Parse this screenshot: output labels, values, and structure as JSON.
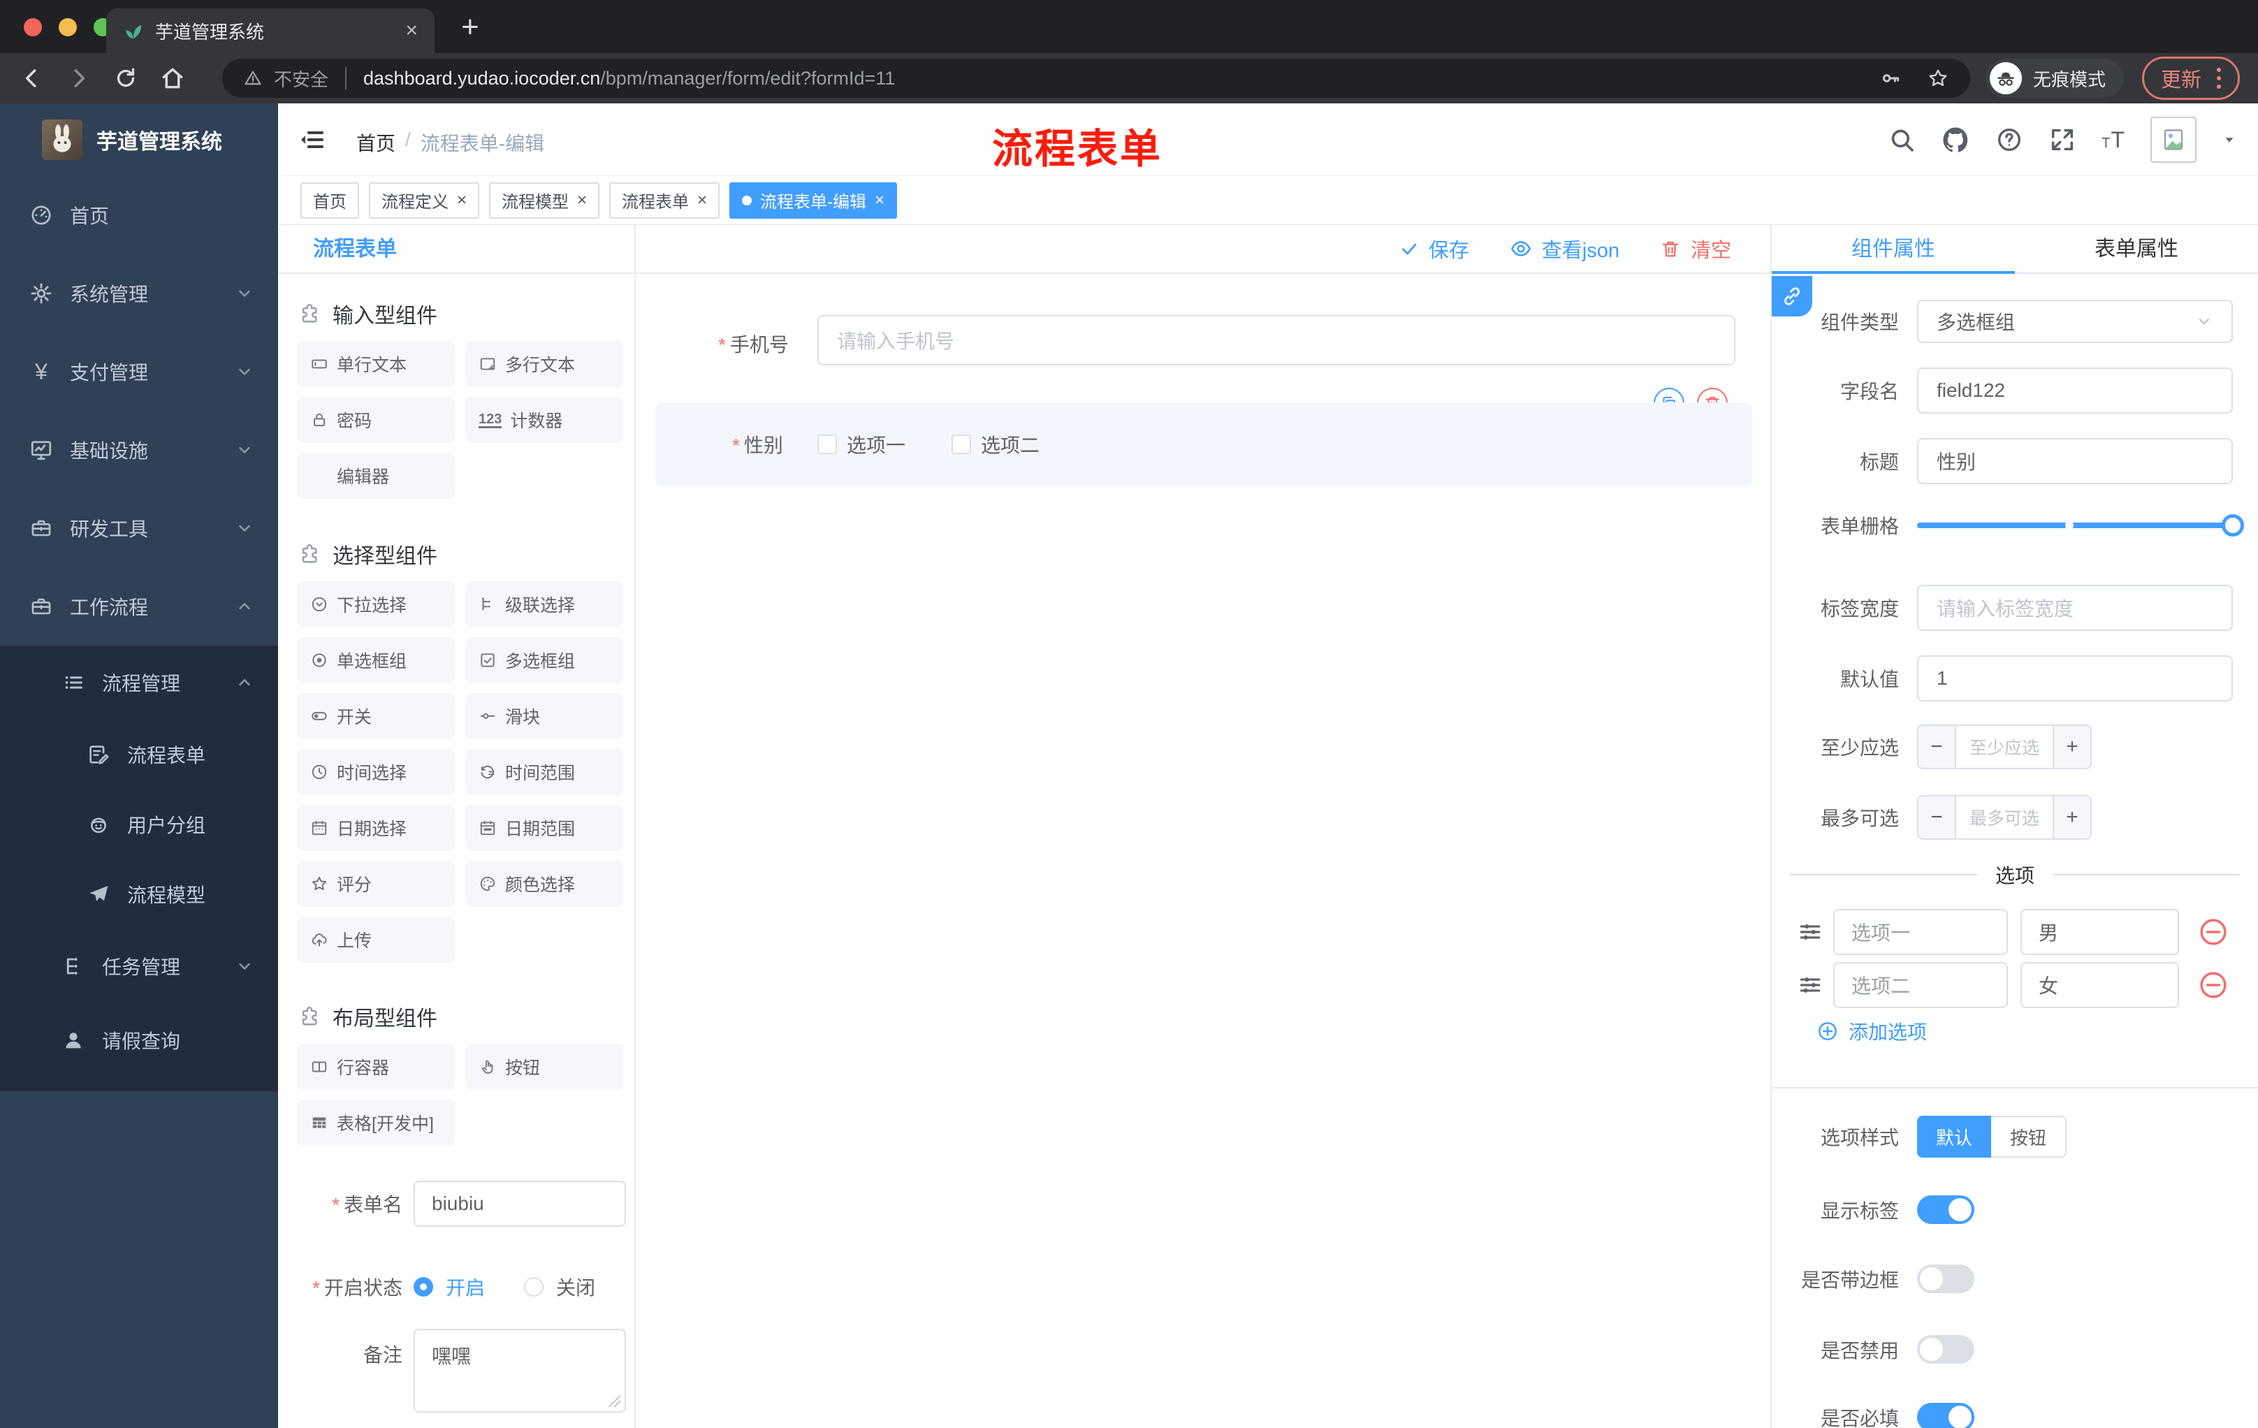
{
  "browser": {
    "tab_title": "芋道管理系统",
    "insecure_label": "不安全",
    "url_host": "dashboard.yudao.iocoder.cn",
    "url_path": "/bpm/manager/form/edit?formId=11",
    "incognito_label": "无痕模式",
    "update_label": "更新"
  },
  "sidebar": {
    "title": "芋道管理系统",
    "items": [
      {
        "label": "首页"
      },
      {
        "label": "系统管理"
      },
      {
        "label": "支付管理"
      },
      {
        "label": "基础设施"
      },
      {
        "label": "研发工具"
      },
      {
        "label": "工作流程"
      },
      {
        "label": "流程管理"
      },
      {
        "label": "流程表单"
      },
      {
        "label": "用户分组"
      },
      {
        "label": "流程模型"
      },
      {
        "label": "任务管理"
      },
      {
        "label": "请假查询"
      }
    ]
  },
  "header": {
    "breadcrumb_home": "首页",
    "breadcrumb_separator": "/",
    "breadcrumb_current": "流程表单-编辑",
    "annotation": "流程表单"
  },
  "tags": {
    "items": [
      {
        "label": "首页",
        "closable": false,
        "active": false
      },
      {
        "label": "流程定义",
        "closable": true,
        "active": false
      },
      {
        "label": "流程模型",
        "closable": true,
        "active": false
      },
      {
        "label": "流程表单",
        "closable": true,
        "active": false
      },
      {
        "label": "流程表单-编辑",
        "closable": true,
        "active": true
      }
    ]
  },
  "designer": {
    "panel_title": "流程表单",
    "toolbar": {
      "save": "保存",
      "view_json": "查看json",
      "clear": "清空"
    },
    "palette": {
      "sections": [
        {
          "title": "输入型组件",
          "items": [
            {
              "label": "单行文本"
            },
            {
              "label": "多行文本"
            },
            {
              "label": "密码"
            },
            {
              "label": "计数器"
            },
            {
              "label": "编辑器"
            }
          ]
        },
        {
          "title": "选择型组件",
          "items": [
            {
              "label": "下拉选择"
            },
            {
              "label": "级联选择"
            },
            {
              "label": "单选框组"
            },
            {
              "label": "多选框组"
            },
            {
              "label": "开关"
            },
            {
              "label": "滑块"
            },
            {
              "label": "时间选择"
            },
            {
              "label": "时间范围"
            },
            {
              "label": "日期选择"
            },
            {
              "label": "日期范围"
            },
            {
              "label": "评分"
            },
            {
              "label": "颜色选择"
            },
            {
              "label": "上传"
            }
          ]
        },
        {
          "title": "布局型组件",
          "items": [
            {
              "label": "行容器"
            },
            {
              "label": "按钮"
            },
            {
              "label": "表格[开发中]"
            }
          ]
        }
      ]
    },
    "canvas": {
      "phone": {
        "label": "手机号",
        "placeholder": "请输入手机号"
      },
      "gender": {
        "label": "性别",
        "options": [
          "选项一",
          "选项二"
        ]
      }
    },
    "meta": {
      "form_name_label": "表单名",
      "form_name_value": "biubiu",
      "status_label": "开启状态",
      "status_on": "开启",
      "status_off": "关闭",
      "status_selected": "开启",
      "remark_label": "备注",
      "remark_value": "嘿嘿"
    }
  },
  "props": {
    "tabs": {
      "component": "组件属性",
      "form": "表单属性"
    },
    "active_tab": "组件属性",
    "fields": {
      "component_type_label": "组件类型",
      "component_type_value": "多选框组",
      "field_name_label": "字段名",
      "field_name_value": "field122",
      "title_label": "标题",
      "title_value": "性别",
      "grid_label": "表单栅格",
      "label_width_label": "标签宽度",
      "label_width_placeholder": "请输入标签宽度",
      "default_label": "默认值",
      "default_value": "1",
      "min_label": "至少应选",
      "min_placeholder": "至少应选",
      "max_label": "最多可选",
      "max_placeholder": "最多可选"
    },
    "options": {
      "divider_title": "选项",
      "rows": [
        {
          "label": "选项一",
          "value": "男"
        },
        {
          "label": "选项二",
          "value": "女"
        }
      ],
      "add_label": "添加选项"
    },
    "style": {
      "label": "选项样式",
      "choice_default": "默认",
      "choice_button": "按钮",
      "selected": "默认",
      "toggles": [
        {
          "label": "显示标签",
          "on": true
        },
        {
          "label": "是否带边框",
          "on": false
        },
        {
          "label": "是否禁用",
          "on": false
        },
        {
          "label": "是否必填",
          "on": true
        }
      ]
    }
  },
  "colors": {
    "primary": "#409eff",
    "danger": "#f56c6c",
    "sidebar_bg": "#304156",
    "submenu_bg": "#1f2d3d",
    "annotation_red": "#fb1c0c"
  }
}
